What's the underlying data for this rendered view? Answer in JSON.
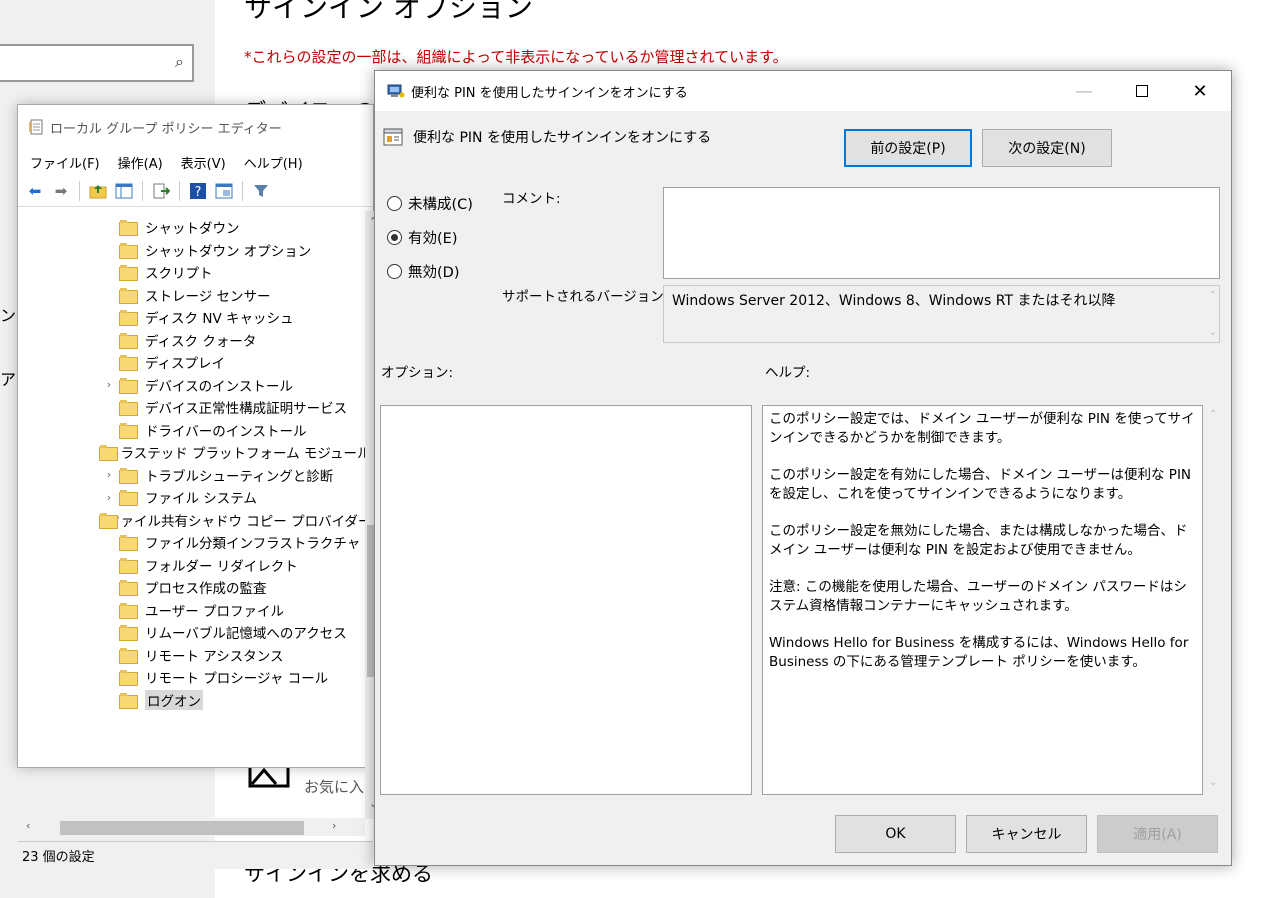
{
  "background": {
    "title": "サインイン オプション",
    "notice": "*これらの設定の一部は、組織によって非表示になっているか管理されています。",
    "heading2": "デバイスへのサ",
    "left_frag1": "ン",
    "left_frag2": "ア",
    "favorites_text": "お気に入り",
    "signin_heading": "サインインを求める"
  },
  "gpe": {
    "title": "ローカル グループ ポリシー エディター",
    "menu": [
      "ファイル(F)",
      "操作(A)",
      "表示(V)",
      "ヘルプ(H)"
    ],
    "toolbar_icons": [
      "back-arrow-icon",
      "forward-arrow-icon",
      "up-folder-icon",
      "show-hide-tree-icon",
      "export-list-icon",
      "help-icon",
      "properties-icon",
      "filter-icon"
    ],
    "tree": [
      {
        "label": "シャットダウン",
        "expandable": false,
        "selected": false
      },
      {
        "label": "シャットダウン オプション",
        "expandable": false,
        "selected": false
      },
      {
        "label": "スクリプト",
        "expandable": false,
        "selected": false
      },
      {
        "label": "ストレージ センサー",
        "expandable": false,
        "selected": false
      },
      {
        "label": "ディスク NV キャッシュ",
        "expandable": false,
        "selected": false
      },
      {
        "label": "ディスク クォータ",
        "expandable": false,
        "selected": false
      },
      {
        "label": "ディスプレイ",
        "expandable": false,
        "selected": false
      },
      {
        "label": "デバイスのインストール",
        "expandable": true,
        "selected": false
      },
      {
        "label": "デバイス正常性構成証明サービス",
        "expandable": false,
        "selected": false
      },
      {
        "label": "ドライバーのインストール",
        "expandable": false,
        "selected": false
      },
      {
        "label": "トラステッド プラットフォーム モジュール",
        "expandable": false,
        "selected": false
      },
      {
        "label": "トラブルシューティングと診断",
        "expandable": true,
        "selected": false
      },
      {
        "label": "ファイル システム",
        "expandable": true,
        "selected": false
      },
      {
        "label": "ファイル共有シャドウ コピー プロバイダー",
        "expandable": false,
        "selected": false
      },
      {
        "label": "ファイル分類インフラストラクチャ",
        "expandable": false,
        "selected": false
      },
      {
        "label": "フォルダー リダイレクト",
        "expandable": false,
        "selected": false
      },
      {
        "label": "プロセス作成の監査",
        "expandable": false,
        "selected": false
      },
      {
        "label": "ユーザー プロファイル",
        "expandable": false,
        "selected": false
      },
      {
        "label": "リムーバブル記憶域へのアクセス",
        "expandable": false,
        "selected": false
      },
      {
        "label": "リモート アシスタンス",
        "expandable": false,
        "selected": false
      },
      {
        "label": "リモート プロシージャ コール",
        "expandable": false,
        "selected": false
      },
      {
        "label": "ログオン",
        "expandable": false,
        "selected": true
      }
    ],
    "status": "23 個の設定"
  },
  "dialog": {
    "title": "便利な PIN を使用したサインインをオンにする",
    "heading": "便利な PIN を使用したサインインをオンにする",
    "prev_button": "前の設定(P)",
    "next_button": "次の設定(N)",
    "radios": [
      {
        "label": "未構成(C)",
        "checked": false
      },
      {
        "label": "有効(E)",
        "checked": true
      },
      {
        "label": "無効(D)",
        "checked": false
      }
    ],
    "comment_label": "コメント:",
    "comment_value": "",
    "supported_label": "サポートされるバージョン:",
    "supported_value": "Windows Server 2012、Windows 8、Windows RT またはそれ以降",
    "options_label": "オプション:",
    "help_label": "ヘルプ:",
    "help_paragraphs": [
      "このポリシー設定では、ドメイン ユーザーが便利な PIN を使ってサインインできるかどうかを制御できます。",
      "このポリシー設定を有効にした場合、ドメイン ユーザーは便利な PIN を設定し、これを使ってサインインできるようになります。",
      "このポリシー設定を無効にした場合、または構成しなかった場合、ドメイン ユーザーは便利な PIN を設定および使用できません。",
      "注意: この機能を使用した場合、ユーザーのドメイン パスワードはシステム資格情報コンテナーにキャッシュされます。",
      "Windows Hello for Business を構成するには、Windows Hello for Business の下にある管理テンプレート ポリシーを使います。"
    ],
    "ok_button": "OK",
    "cancel_button": "キャンセル",
    "apply_button": "適用(A)"
  }
}
